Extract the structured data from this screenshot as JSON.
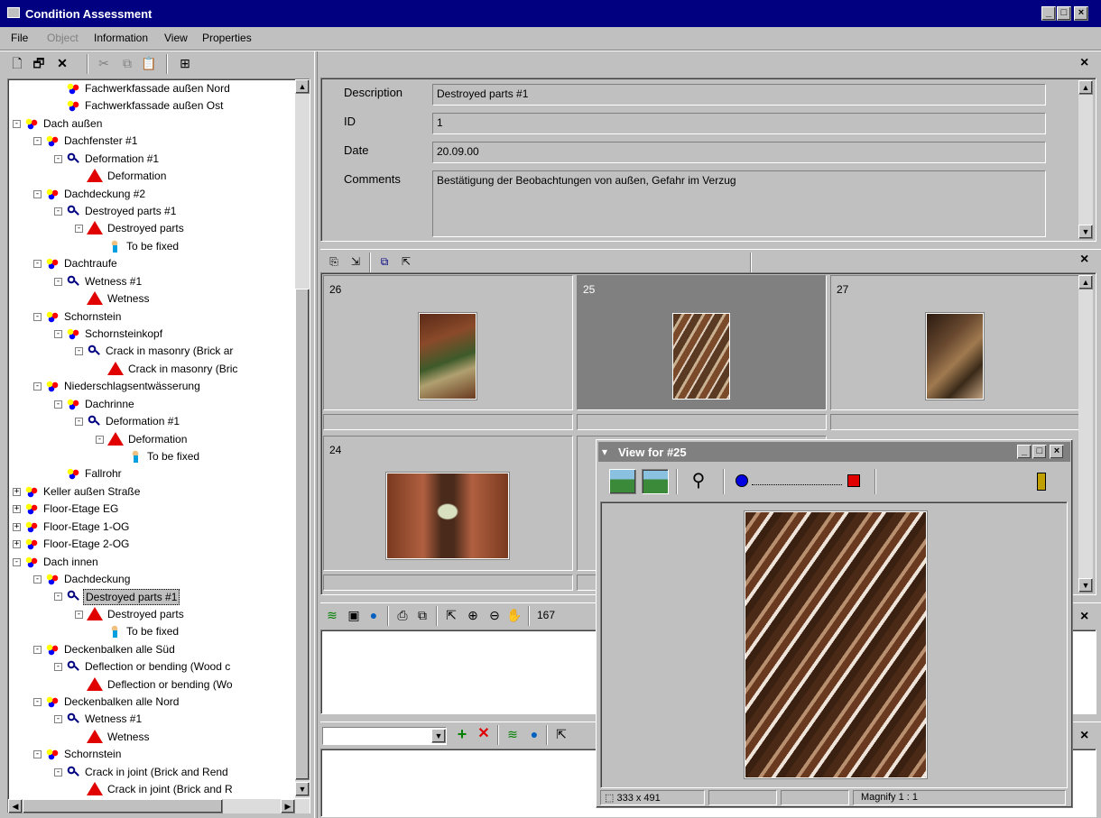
{
  "window": {
    "title": "Condition Assessment",
    "min": "_",
    "max": "□",
    "close": "×"
  },
  "menu": [
    "File",
    "Object",
    "Information",
    "View",
    "Properties"
  ],
  "toolbar": {
    "new": "🗋",
    "props": "🗗",
    "delete": "✕",
    "cut": "✂",
    "copy": "⧉",
    "paste": "📋",
    "tree": "⊞"
  },
  "tree": {
    "nodes": [
      {
        "label": "Fachwerkfassade außen Nord",
        "icon": "gear"
      },
      {
        "label": "Fachwerkfassade außen Ost",
        "icon": "gear"
      },
      {
        "label": "Dach außen",
        "icon": "gear",
        "exp": "-"
      },
      {
        "label": "Dachfenster #1",
        "icon": "gear",
        "exp": "-"
      },
      {
        "label": "Deformation #1",
        "icon": "mag",
        "exp": "-"
      },
      {
        "label": "Deformation",
        "icon": "warn"
      },
      {
        "label": "Dachdeckung #2",
        "icon": "gear",
        "exp": "-"
      },
      {
        "label": "Destroyed parts #1",
        "icon": "mag",
        "exp": "-"
      },
      {
        "label": "Destroyed parts",
        "icon": "warn",
        "exp": "-"
      },
      {
        "label": "To be fixed",
        "icon": "fix"
      },
      {
        "label": "Dachtraufe",
        "icon": "gear",
        "exp": "-"
      },
      {
        "label": "Wetness #1",
        "icon": "mag",
        "exp": "-"
      },
      {
        "label": "Wetness",
        "icon": "warn"
      },
      {
        "label": "Schornstein",
        "icon": "gear",
        "exp": "-"
      },
      {
        "label": "Schornsteinkopf",
        "icon": "gear",
        "exp": "-"
      },
      {
        "label": "Crack in masonry (Brick ar",
        "icon": "mag",
        "exp": "-"
      },
      {
        "label": "Crack in masonry (Bric",
        "icon": "warn"
      },
      {
        "label": "Niederschlagsentwässerung",
        "icon": "gear",
        "exp": "-"
      },
      {
        "label": "Dachrinne",
        "icon": "gear",
        "exp": "-"
      },
      {
        "label": "Deformation #1",
        "icon": "mag",
        "exp": "-"
      },
      {
        "label": "Deformation",
        "icon": "warn",
        "exp": "-"
      },
      {
        "label": "To be fixed",
        "icon": "fix"
      },
      {
        "label": "Fallrohr",
        "icon": "gear"
      },
      {
        "label": "Keller außen Straße",
        "icon": "gear",
        "exp": "+"
      },
      {
        "label": "Floor-Etage EG",
        "icon": "gear",
        "exp": "+"
      },
      {
        "label": "Floor-Etage 1-OG",
        "icon": "gear",
        "exp": "+"
      },
      {
        "label": "Floor-Etage 2-OG",
        "icon": "gear",
        "exp": "+"
      },
      {
        "label": "Dach innen",
        "icon": "gear",
        "exp": "-"
      },
      {
        "label": "Dachdeckung",
        "icon": "gear",
        "exp": "-"
      },
      {
        "label": "Destroyed parts #1",
        "icon": "mag",
        "exp": "-",
        "selected": true
      },
      {
        "label": "Destroyed parts",
        "icon": "warn",
        "exp": "-"
      },
      {
        "label": "To be fixed",
        "icon": "fix"
      },
      {
        "label": "Deckenbalken alle Süd",
        "icon": "gear",
        "exp": "-"
      },
      {
        "label": "Deflection or bending (Wood c",
        "icon": "mag",
        "exp": "-"
      },
      {
        "label": "Deflection or bending (Wo",
        "icon": "warn"
      },
      {
        "label": "Deckenbalken alle Nord",
        "icon": "gear",
        "exp": "-"
      },
      {
        "label": "Wetness #1",
        "icon": "mag",
        "exp": "-"
      },
      {
        "label": "Wetness",
        "icon": "warn"
      },
      {
        "label": "Schornstein",
        "icon": "gear",
        "exp": "-"
      },
      {
        "label": "Crack in joint (Brick and Rend",
        "icon": "mag",
        "exp": "-"
      },
      {
        "label": "Crack in joint (Brick and R",
        "icon": "warn"
      }
    ]
  },
  "details": {
    "description_label": "Description",
    "description": "Destroyed parts #1",
    "id_label": "ID",
    "id": "1",
    "date_label": "Date",
    "date": "20.09.00",
    "comments_label": "Comments",
    "comments": "Bestätigung der Beobachtungen von außen, Gefahr im Verzug"
  },
  "thumbs": [
    {
      "num": "26",
      "selected": false
    },
    {
      "num": "25",
      "selected": true
    },
    {
      "num": "27",
      "selected": false
    },
    {
      "num": "24",
      "selected": false
    }
  ],
  "drawing_toolbar": {
    "zoom_text": "167"
  },
  "close_glyph": "×",
  "viewer": {
    "title": "View for #25",
    "size": "333 x 491",
    "magnify": "Magnify 1 : 1"
  },
  "colors": {
    "titlebar": "#000080",
    "inactive_title": "#808080",
    "warn": "#e00000"
  }
}
